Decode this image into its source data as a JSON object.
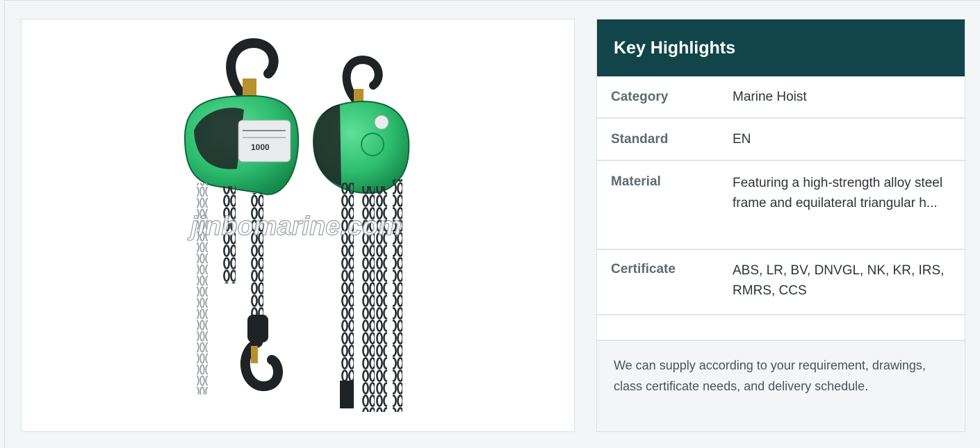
{
  "product_image": {
    "alt": "Chain hoists",
    "watermark": "jinbomarine.com",
    "nameplate_text": "1000"
  },
  "highlights": {
    "title": "Key Highlights",
    "rows": [
      {
        "label": "Category",
        "value": "Marine Hoist"
      },
      {
        "label": "Standard",
        "value": "EN"
      },
      {
        "label": "Material",
        "value": "Featuring a high-strength alloy steel frame and equilateral triangular h..."
      },
      {
        "label": "Certificate",
        "value": "ABS, LR, BV, DNVGL, NK, KR, IRS, RMRS, CCS"
      }
    ],
    "note": "We can supply according to your requirement, drawings, class certificate needs, and delivery schedule."
  },
  "colors": {
    "header_bg": "#12454a",
    "hoist_green": "#2dbd6e",
    "chain": "#2a2f33"
  }
}
